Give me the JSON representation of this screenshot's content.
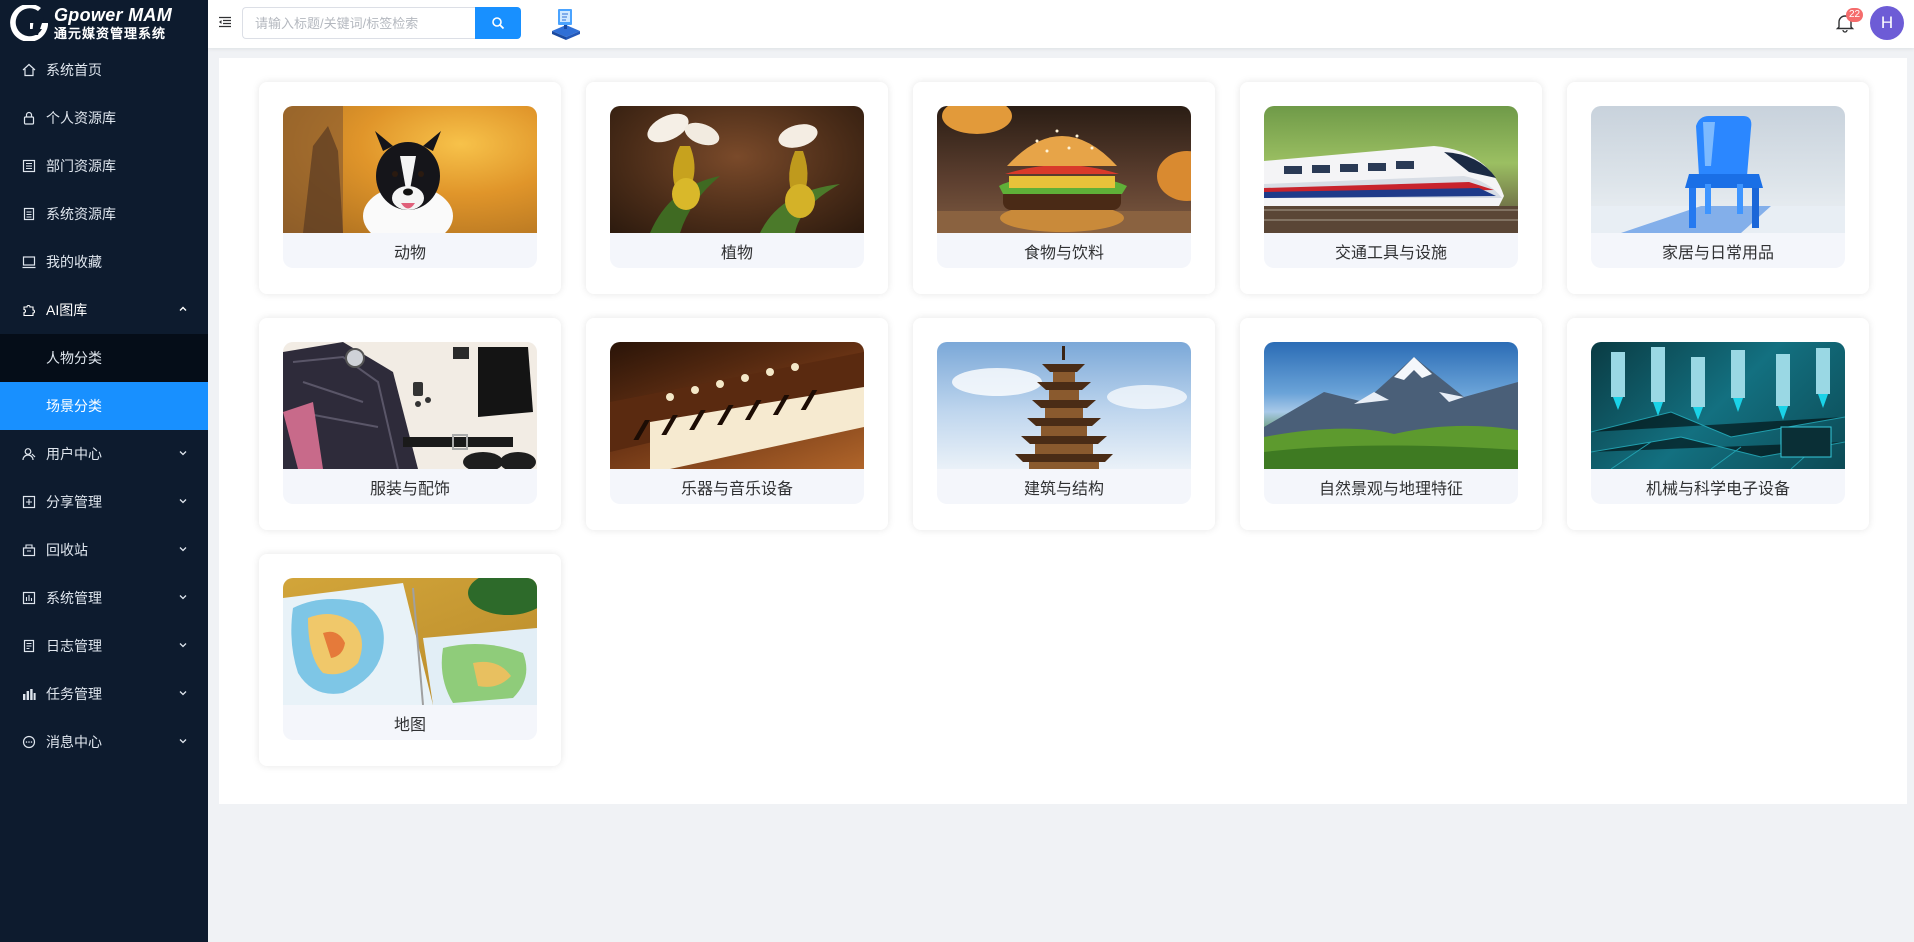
{
  "app": {
    "logo_en": "Gpower MAM",
    "logo_cn": "通元媒资管理系统"
  },
  "sidebar": {
    "items": [
      {
        "label": "系统首页",
        "icon": "home-icon"
      },
      {
        "label": "个人资源库",
        "icon": "lock-icon"
      },
      {
        "label": "部门资源库",
        "icon": "building-icon"
      },
      {
        "label": "系统资源库",
        "icon": "list-icon"
      },
      {
        "label": "我的收藏",
        "icon": "monitor-icon"
      },
      {
        "label": "AI图库",
        "icon": "puzzle-icon"
      },
      {
        "label": "用户中心",
        "icon": "user-icon"
      },
      {
        "label": "分享管理",
        "icon": "share-icon"
      },
      {
        "label": "回收站",
        "icon": "bin-icon"
      },
      {
        "label": "系统管理",
        "icon": "settings-icon"
      },
      {
        "label": "日志管理",
        "icon": "log-icon"
      },
      {
        "label": "任务管理",
        "icon": "chart-icon"
      },
      {
        "label": "消息中心",
        "icon": "chat-icon"
      }
    ],
    "ai_submenu": [
      {
        "label": "人物分类"
      },
      {
        "label": "场景分类"
      }
    ]
  },
  "header": {
    "search_placeholder": "请输入标题/关键词/标签检索",
    "notification_count": "22",
    "avatar_letter": "H"
  },
  "categories": [
    {
      "label": "动物",
      "image": "dog"
    },
    {
      "label": "植物",
      "image": "orchid"
    },
    {
      "label": "食物与饮料",
      "image": "burger"
    },
    {
      "label": "交通工具与设施",
      "image": "train"
    },
    {
      "label": "家居与日常用品",
      "image": "chair"
    },
    {
      "label": "服装与配饰",
      "image": "clothes"
    },
    {
      "label": "乐器与音乐设备",
      "image": "piano"
    },
    {
      "label": "建筑与结构",
      "image": "pagoda"
    },
    {
      "label": "自然景观与地理特征",
      "image": "mountain"
    },
    {
      "label": "机械与科学电子设备",
      "image": "circuit"
    },
    {
      "label": "地图",
      "image": "atlas"
    }
  ],
  "colors": {
    "sidebar_bg": "#0d1b2e",
    "submenu_bg": "#050d18",
    "accent": "#1890ff",
    "badge": "#f56c6c",
    "avatar": "#6d5cd6"
  }
}
